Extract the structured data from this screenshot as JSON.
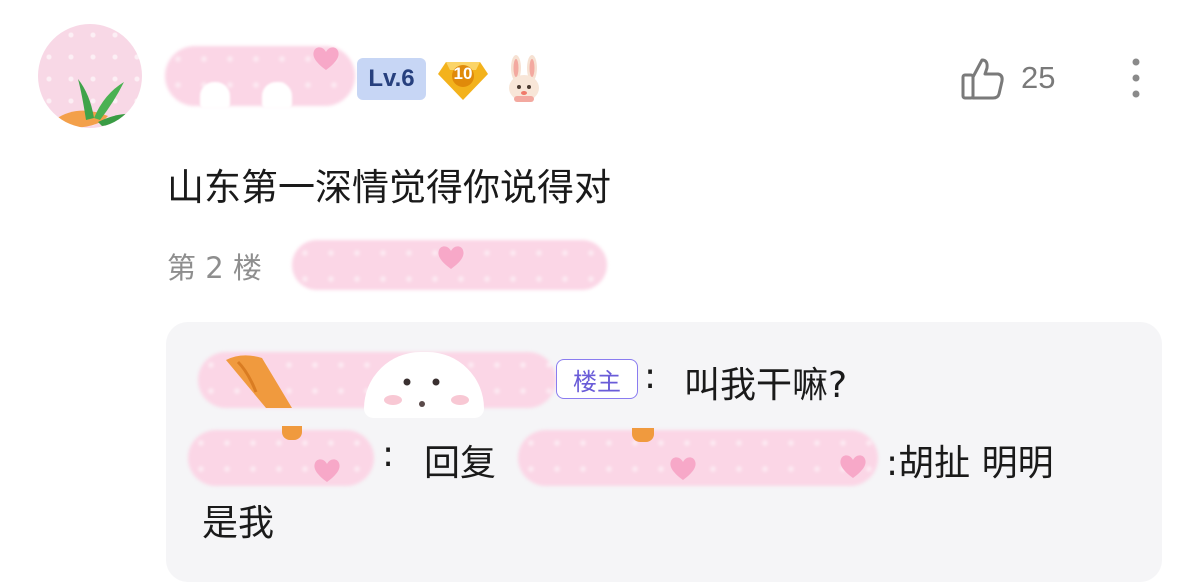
{
  "comment": {
    "level_badge": "Lv.6",
    "member_level": "10",
    "likes": "25",
    "text": "山东第一深情觉得你说得对",
    "floor": "第 2 楼"
  },
  "replies": [
    {
      "owner_tag": "楼主",
      "separator": ":",
      "text": "叫我干嘛?"
    },
    {
      "separator": ":",
      "reply_word": "回复",
      "text_tail": ":胡扯 明明",
      "text_wrap": "是我"
    }
  ],
  "colors": {
    "sticker_pink": "#fbd6e6",
    "level_badge_bg": "#c7d6f5",
    "owner_tag_border": "#8a7cf0",
    "reply_box_bg": "#f5f5f7"
  },
  "icons": [
    "thumbs-up-icon",
    "more-vertical-icon",
    "diamond-badge-icon",
    "rabbit-badge-icon"
  ]
}
